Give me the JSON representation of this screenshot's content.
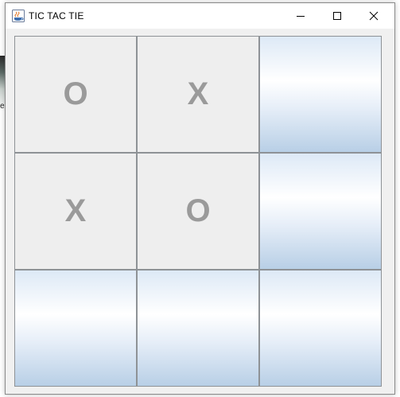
{
  "window": {
    "title": "TIC TAC TIE"
  },
  "board": {
    "cells": [
      {
        "mark": "O",
        "state": "filled"
      },
      {
        "mark": "X",
        "state": "filled"
      },
      {
        "mark": "",
        "state": "empty"
      },
      {
        "mark": "X",
        "state": "filled"
      },
      {
        "mark": "O",
        "state": "filled"
      },
      {
        "mark": "",
        "state": "empty"
      },
      {
        "mark": "",
        "state": "empty"
      },
      {
        "mark": "",
        "state": "empty"
      },
      {
        "mark": "",
        "state": "empty"
      }
    ]
  },
  "colors": {
    "mark": "#9a9a9a",
    "filled_cell": "#eeeeee",
    "grid_line": "#8e9296"
  }
}
